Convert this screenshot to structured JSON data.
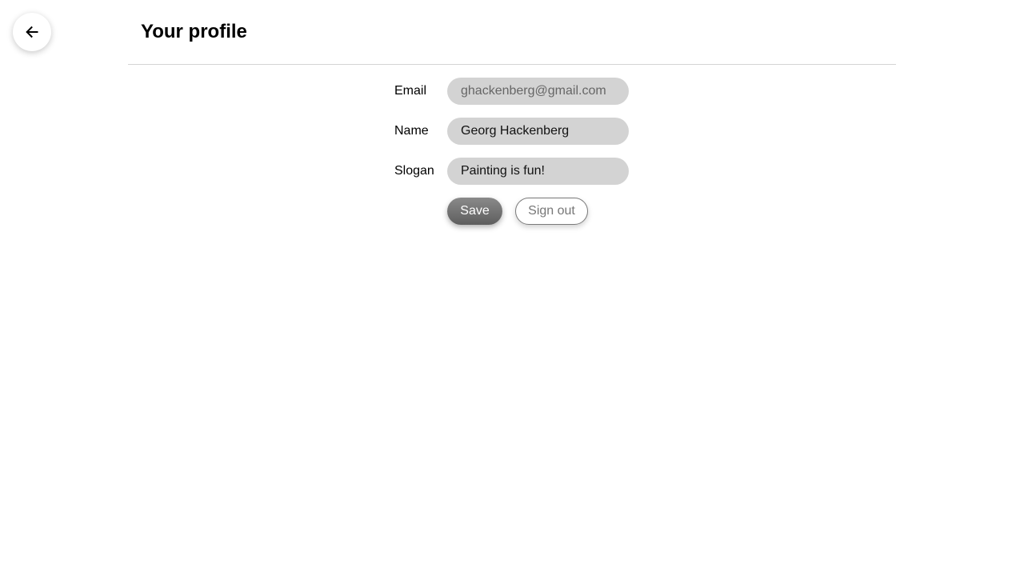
{
  "header": {
    "title": "Your profile",
    "back_icon": "arrow-left-icon"
  },
  "form": {
    "email_label": "Email",
    "email_value": "ghackenberg@gmail.com",
    "name_label": "Name",
    "name_value": "Georg Hackenberg",
    "slogan_label": "Slogan",
    "slogan_value": "Painting is fun!"
  },
  "actions": {
    "save_label": "Save",
    "signout_label": "Sign out"
  }
}
